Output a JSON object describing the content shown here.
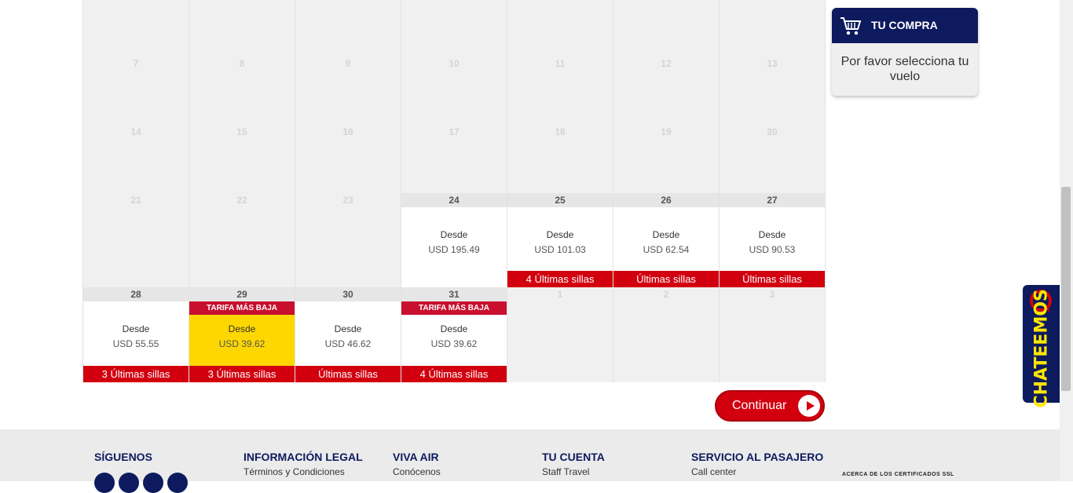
{
  "calendar": {
    "rows": [
      {
        "days": [
          "",
          "",
          "",
          "",
          "",
          "",
          ""
        ]
      },
      {
        "days": [
          "7",
          "8",
          "9",
          "10",
          "11",
          "12",
          "13"
        ]
      },
      {
        "days": [
          "14",
          "15",
          "16",
          "17",
          "18",
          "19",
          "20"
        ]
      },
      {
        "days": [
          "21",
          "22",
          "23",
          "24",
          "25",
          "26",
          "27"
        ]
      },
      {
        "days": [
          "28",
          "29",
          "30",
          "31",
          "1",
          "2",
          "3"
        ]
      }
    ],
    "flights": {
      "24": {
        "desde": "Desde",
        "price": "USD 195.49",
        "seats": ""
      },
      "25": {
        "desde": "Desde",
        "price": "USD 101.03",
        "seats": "4 Últimas sillas"
      },
      "26": {
        "desde": "Desde",
        "price": "USD 62.54",
        "seats": "Últimas sillas"
      },
      "27": {
        "desde": "Desde",
        "price": "USD 90.53",
        "seats": "Últimas sillas"
      },
      "28": {
        "desde": "Desde",
        "price": "USD 55.55",
        "seats": "3 Últimas sillas"
      },
      "29": {
        "desde": "Desde",
        "price": "USD 39.62",
        "seats": "3 Últimas sillas",
        "badge": "TARIFA MÁS BAJA",
        "selected": true
      },
      "30": {
        "desde": "Desde",
        "price": "USD 46.62",
        "seats": "Últimas sillas"
      },
      "31": {
        "desde": "Desde",
        "price": "USD 39.62",
        "seats": "4 Últimas sillas",
        "badge": "TARIFA MÁS BAJA"
      }
    }
  },
  "continue_button": {
    "label": "Continuar"
  },
  "purchase_panel": {
    "title": "TU COMPRA",
    "message": "Por favor selecciona tu vuelo",
    "icon": "shopping-cart-icon"
  },
  "chat": {
    "label": "CHATEEMOS",
    "icon": "chat-bubble-icon"
  },
  "footer": {
    "columns": [
      {
        "heading": "SÍGUENOS",
        "link": ""
      },
      {
        "heading": "INFORMACIÓN LEGAL",
        "link": "Términos y Condiciones"
      },
      {
        "heading": "VIVA AIR",
        "link": "Conócenos"
      },
      {
        "heading": "TU CUENTA",
        "link": "Staff Travel"
      },
      {
        "heading": "SERVICIO AL PASAJERO",
        "link": "Call center"
      }
    ],
    "social_icons": [
      "facebook-icon",
      "twitter-icon",
      "instagram-icon",
      "linkedin-icon"
    ],
    "ssl_text": "ACERCA DE LOS CERTIFICADOS SSL"
  },
  "colors": {
    "brand_navy": "#0d1a5e",
    "brand_red": "#d2000f",
    "selected_yellow": "#ffd700",
    "chat_yellow": "#ffe600"
  }
}
